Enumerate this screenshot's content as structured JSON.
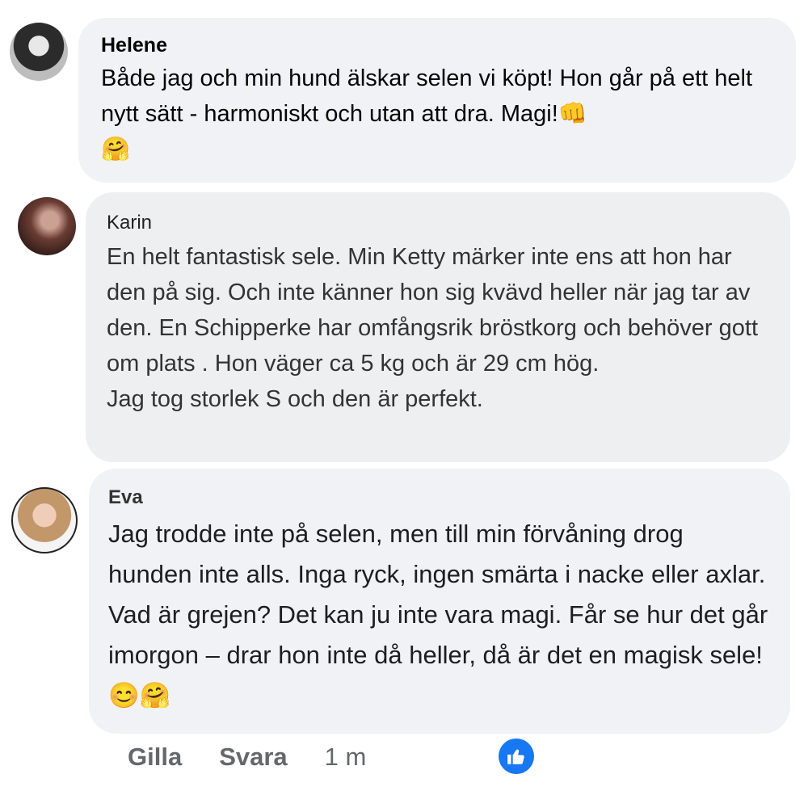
{
  "comments": [
    {
      "author": "Helene",
      "author_extra": "",
      "text": "Både jag och min hund älskar selen vi köpt! Hon går på ett helt nytt sätt - harmoniskt och utan att dra. Magi!👊\n🤗"
    },
    {
      "author": "Karin",
      "author_extra": "",
      "text": "En helt fantastisk sele. Min Ketty märker inte ens att hon har den på sig. Och inte känner hon sig kvävd heller när jag tar av den. En Schipperke har omfångsrik bröstkorg och behöver gott om plats . Hon väger ca 5 kg och är 29 cm hög.\nJag tog storlek S och den är perfekt."
    },
    {
      "author": "Eva",
      "author_extra": "",
      "text": "Jag trodde inte på selen, men till min förvåning drog hunden inte alls. Inga ryck, ingen smärta i nacke eller axlar. Vad är grejen? Det kan ju inte vara magi. Får se hur det går imorgon – drar hon inte då heller, då är det en magisk sele! 😊🤗"
    }
  ],
  "actions": {
    "like": "Gilla",
    "reply": "Svara",
    "time": "1 m"
  },
  "icons": {
    "like_badge": "thumbs-up-icon",
    "like_badge_color": "#1877f2"
  }
}
